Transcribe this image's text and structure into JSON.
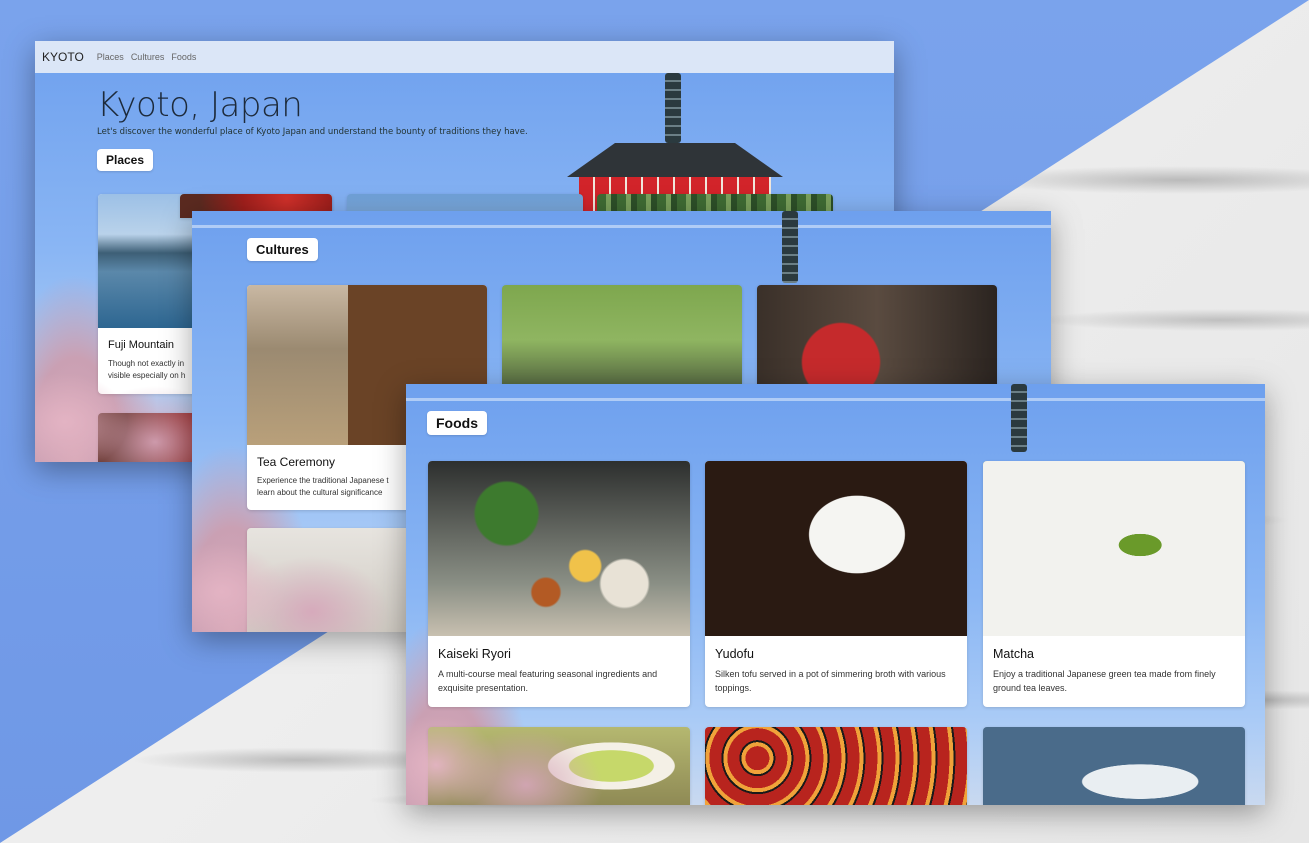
{
  "app": {
    "brand": "KYOTO",
    "nav": [
      "Places",
      "Cultures",
      "Foods"
    ]
  },
  "hero": {
    "title": "Kyoto, Japan",
    "subtitle": "Let's discover the wonderful place of Kyoto Japan and understand the bounty of traditions they have."
  },
  "places": {
    "heading": "Places",
    "cards": [
      {
        "title": "Fuji Mountain",
        "desc_line1": "Though not exactly in",
        "desc_line2": "visible especially on h"
      }
    ]
  },
  "cultures": {
    "heading": "Cultures",
    "cards": [
      {
        "title": "Tea Ceremony",
        "desc_line1": "Experience the traditional Japanese t",
        "desc_line2": "learn about the cultural significance"
      }
    ]
  },
  "foods": {
    "heading": "Foods",
    "cards": [
      {
        "title": "Kaiseki Ryori",
        "desc": "A multi-course meal featuring seasonal ingredients and exquisite presentation."
      },
      {
        "title": "Yudofu",
        "desc": "Silken tofu served in a pot of simmering broth with various toppings."
      },
      {
        "title": "Matcha",
        "desc": "Enjoy a traditional Japanese green tea made from finely ground tea leaves."
      }
    ]
  },
  "colors": {
    "background_blue": "#7aa3ec",
    "navbar": "#dbe6f7",
    "pagoda_red": "#d2242a"
  }
}
